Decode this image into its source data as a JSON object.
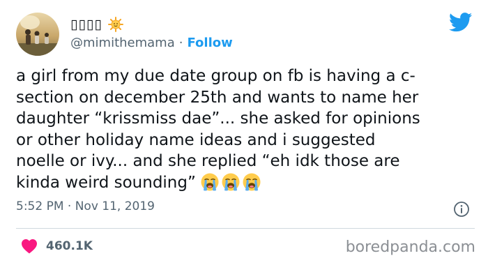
{
  "tweet": {
    "display_name": "▯▯▯▯",
    "handle": "@mimithemama",
    "separator": "·",
    "follow_label": "Follow",
    "text": "a girl from my due date group on fb is having a c-\nsection on december 25th and wants to name her\ndaughter “krissmiss dae”... she asked for opinions\nor other holiday name ideas and i suggested\nnoelle or ivy... and she replied “eh idk those are\nkinda weird sounding”",
    "text_emojis": [
      "loudly-crying-face",
      "loudly-crying-face",
      "loudly-crying-face"
    ],
    "timestamp": "5:52 PM · Nov 11, 2019",
    "likes": "460.1K"
  },
  "icons": {
    "name_badge": "sun-emoji-icon",
    "platform": "twitter-bird-icon",
    "info": "info-icon",
    "like": "heart-icon"
  },
  "colors": {
    "link_blue": "#1d9bf0",
    "heart_pink": "#f91880",
    "text_dark": "#0f1419",
    "text_gray": "#536471",
    "divider": "#cfd9de"
  },
  "watermark": "boredpanda.com"
}
